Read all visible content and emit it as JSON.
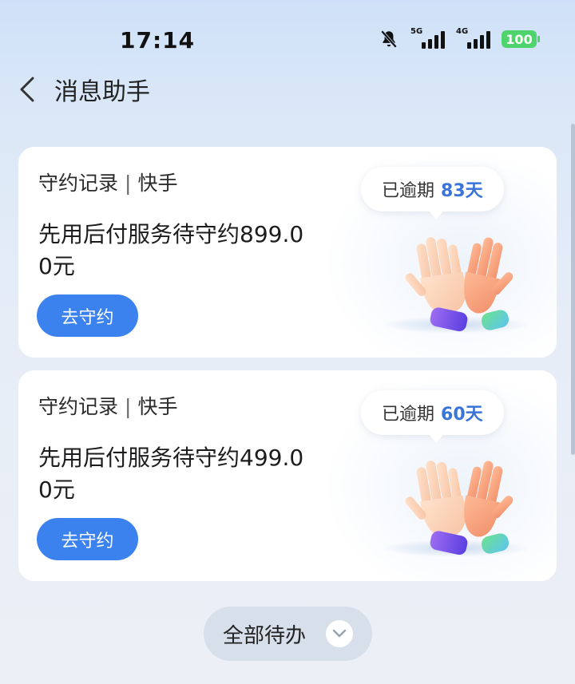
{
  "status_bar": {
    "time": "17:14",
    "network_1": "5G",
    "network_2": "4G",
    "battery": "100"
  },
  "header": {
    "title": "消息助手"
  },
  "cards": [
    {
      "record_label": "守约记录",
      "separator": "|",
      "source": "快手",
      "message": "先用后付服务待守约899.00元",
      "button_label": "去守约",
      "overdue_label": "已逾期",
      "overdue_days": "83天"
    },
    {
      "record_label": "守约记录",
      "separator": "|",
      "source": "快手",
      "message": "先用后付服务待守约499.00元",
      "button_label": "去守约",
      "overdue_label": "已逾期",
      "overdue_days": "60天"
    }
  ],
  "footer": {
    "all_todo_label": "全部待办"
  },
  "colors": {
    "accent": "#3b82ee",
    "days_text": "#3b74d8",
    "battery": "#4fd36c"
  },
  "icons": [
    "back-arrow-icon",
    "bell-off-icon",
    "signal-icon",
    "battery-icon",
    "high-five-hands-icon",
    "chevron-down-icon"
  ]
}
